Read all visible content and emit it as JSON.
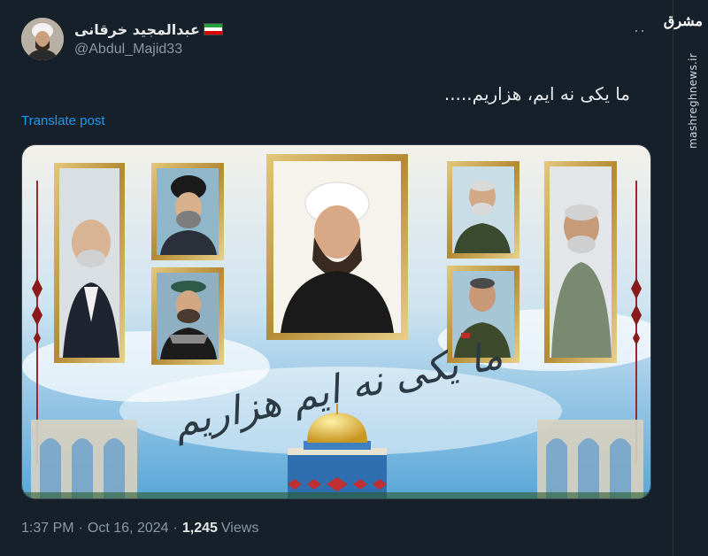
{
  "author": {
    "display_name": "عبدالمجید خرقانی",
    "handle": "@Abdul_Majid33",
    "flag_icon": "iran-flag-icon"
  },
  "tweet": {
    "text": "ما یکی نه ایم، هزاریم.....",
    "translate_label": "Translate post"
  },
  "media": {
    "calligraphy": "ما یکی نه ایم هزاریم"
  },
  "meta": {
    "time": "1:37 PM",
    "separator": "·",
    "date": "Oct 16, 2024",
    "views_count": "1,245",
    "views_label": "Views"
  },
  "watermark": {
    "site": "mashreghnews.ir",
    "logo": "مشرق"
  },
  "colors": {
    "background": "#15202b",
    "link": "#1d9bf0",
    "secondary_text": "#8b98a5",
    "frame_gold": "#c9a24a"
  }
}
